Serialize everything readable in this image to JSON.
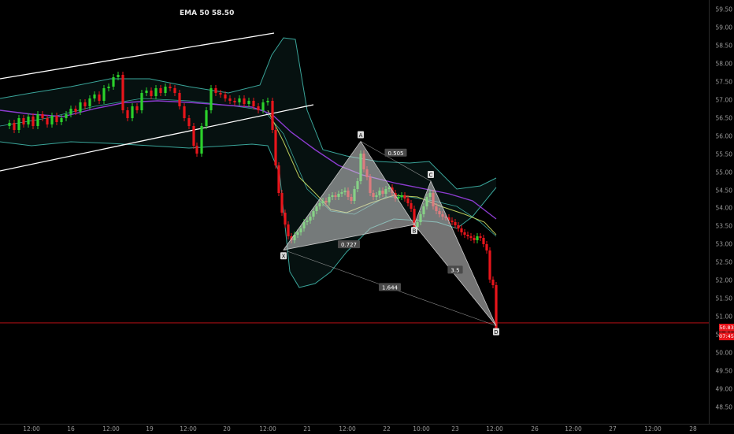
{
  "indicator": {
    "ema_label": "EMA 50 58.50"
  },
  "price_axis": {
    "ticks": [
      "59.50",
      "59.00",
      "58.50",
      "58.00",
      "57.50",
      "57.00",
      "56.50",
      "56.00",
      "55.50",
      "55.00",
      "54.50",
      "54.00",
      "53.50",
      "53.00",
      "52.50",
      "52.00",
      "51.50",
      "51.00",
      "50.50",
      "50.00",
      "49.50",
      "49.00",
      "48.50"
    ],
    "min": 48.5,
    "max": 59.5,
    "current_price": "50.83",
    "countdown": "07:45"
  },
  "time_axis": {
    "ticks": [
      "12:00",
      "16",
      "12:00",
      "19",
      "12:00",
      "20",
      "12:00",
      "21",
      "12:00",
      "22",
      "10:00",
      "23",
      "12:00",
      "26",
      "12:00",
      "27",
      "12:00",
      "28"
    ]
  },
  "pattern": {
    "points": [
      {
        "name": "X",
        "price": 52.85
      },
      {
        "name": "A",
        "price": 55.85
      },
      {
        "name": "B",
        "price": 53.55
      },
      {
        "name": "C",
        "price": 54.75
      },
      {
        "name": "D",
        "price": 50.75
      }
    ],
    "ratios": {
      "xb": "0.727",
      "ac": "0.505",
      "bd": "3.5",
      "xd": "1.644"
    }
  },
  "colors": {
    "bull": "#2bd12b",
    "bear": "#e8151b",
    "bb": "#3aa59a",
    "ema": "#8c3cd0",
    "channel": "#ffffff",
    "ma": "#b9c95a",
    "pattern": "#c8c8c8",
    "price_line": "#e8151b"
  }
}
